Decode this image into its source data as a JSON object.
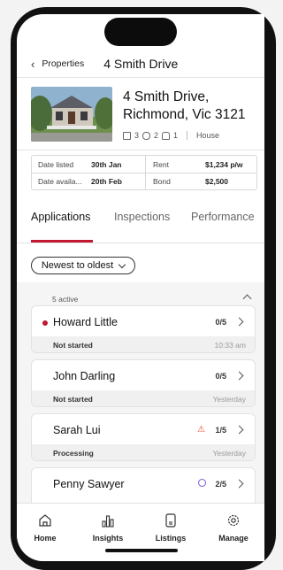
{
  "nav": {
    "back_label": "Properties",
    "title": "4 Smith Drive"
  },
  "property": {
    "address_line1": "4 Smith Drive,",
    "address_line2": "Richmond, Vic 3121",
    "beds": "3",
    "baths": "2",
    "cars": "1",
    "type": "House"
  },
  "details": {
    "date_listed_label": "Date listed",
    "date_listed": "30th Jan",
    "rent_label": "Rent",
    "rent": "$1,234 p/w",
    "date_available_label": "Date availa...",
    "date_available": "20th Feb",
    "bond_label": "Bond",
    "bond": "$2,500"
  },
  "tabs": [
    "Applications",
    "Inspections",
    "Performance"
  ],
  "active_tab": "Applications",
  "sort": {
    "label": "Newest to oldest"
  },
  "list": {
    "active_count": "5 active",
    "applications": [
      {
        "name": "Howard Little",
        "score": "0/5",
        "status": "Not started",
        "time": "10:33 am",
        "unread": true
      },
      {
        "name": "John Darling",
        "score": "0/5",
        "status": "Not started",
        "time": "Yesterday",
        "unread": false
      },
      {
        "name": "Sarah Lui",
        "score": "1/5",
        "status": "Processing",
        "time": "Yesterday",
        "indicator": "warning-icon"
      },
      {
        "name": "Penny Sawyer",
        "score": "2/5",
        "status": "",
        "time": "",
        "indicator": "clock-icon"
      }
    ]
  },
  "bottom_nav": [
    {
      "label": "Home",
      "icon": "home-icon"
    },
    {
      "label": "Insights",
      "icon": "bar-chart-icon"
    },
    {
      "label": "Listings",
      "icon": "document-icon"
    },
    {
      "label": "Manage",
      "icon": "gear-icon"
    }
  ],
  "colors": {
    "accent": "#c0182f",
    "warning": "#e04a28",
    "pending": "#7b5cd6"
  }
}
